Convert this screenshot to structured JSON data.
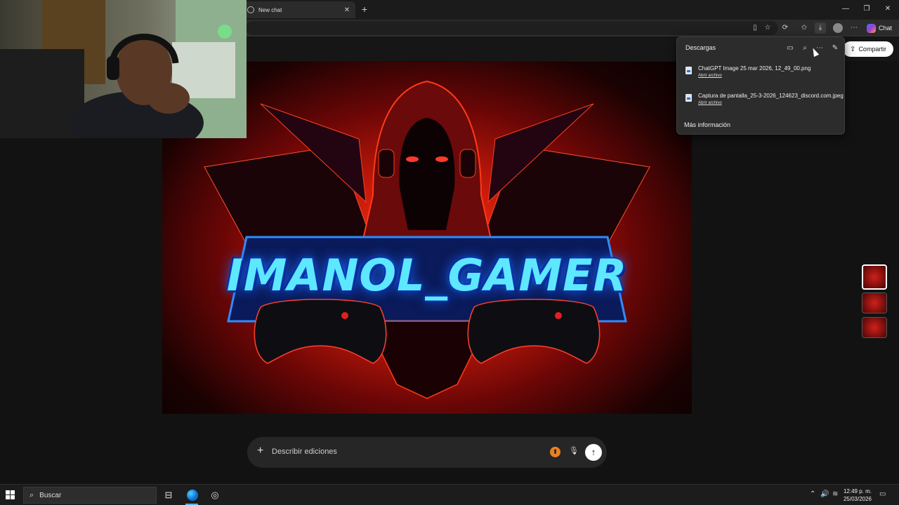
{
  "browser": {
    "tab_title": "New chat",
    "tab_close": "✕",
    "new_tab": "+",
    "window_controls": {
      "minimize": "—",
      "restore": "❐",
      "close": "✕"
    },
    "copilot_label": "Chat",
    "toolbar_icons": [
      "reading-view-icon",
      "favorite-star-icon",
      "extensions-icon",
      "favorites-icon",
      "downloads-icon",
      "profile-icon",
      "more-icon"
    ]
  },
  "page": {
    "share_label": "Compartir",
    "image_title": "IMANOL_GAMER",
    "thumbnails": 3,
    "prompt": {
      "placeholder": "Describir ediciones",
      "plus": "+",
      "send": "↑"
    }
  },
  "downloads": {
    "title": "Descargas",
    "items": [
      {
        "name": "ChatGPT Image 25 mar 2026, 12_49_00.png",
        "action": "Abrir archivo"
      },
      {
        "name": "Captura de pantalla_25-3-2026_124623_discord.com.jpeg",
        "action": "Abrir archivo"
      }
    ],
    "more_info": "Más información"
  },
  "taskbar": {
    "search_label": "Buscar",
    "clock_time": "12:49 p. m.",
    "clock_date": "25/03/2026"
  },
  "colors": {
    "accent_blue": "#5ab2ff",
    "prompt_orange": "#e8811f",
    "art_red": "#c91a0a",
    "title_cyan": "#5ee8ff"
  }
}
